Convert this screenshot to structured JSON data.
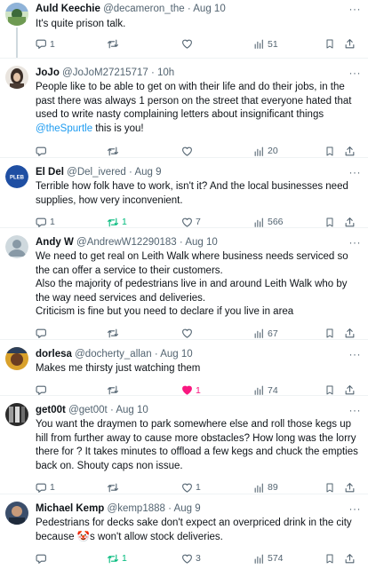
{
  "tweets": [
    {
      "name": "Auld Keechie",
      "handle": "@decameron_the",
      "sep": "·",
      "time": "Aug 10",
      "text": "It's quite prison talk.",
      "reply_count": "1",
      "retweet_count": "",
      "like_count": "",
      "views": "51",
      "liked": false,
      "retweeted": false
    },
    {
      "name": "JoJo",
      "handle": "@JoJoM27215717",
      "sep": "·",
      "time": "10h",
      "text_before": "People like to be able to get on with their life and do their jobs, in the past there was always 1 person on the street that everyone hated that used to write nasty complaining letters about insignificant things ",
      "mention": "@theSpurtle",
      "text_after": " this is you!",
      "reply_count": "",
      "retweet_count": "",
      "like_count": "",
      "views": "20",
      "liked": false,
      "retweeted": false
    },
    {
      "name": "El Del",
      "handle": "@Del_ivered",
      "sep": "·",
      "time": "Aug 9",
      "avatar_text": "PLEB",
      "text": "Terrible how folk have to work, isn't it? And the local businesses need supplies, how very inconvenient.",
      "reply_count": "1",
      "retweet_count": "1",
      "like_count": "7",
      "views": "566",
      "liked": false,
      "retweeted": true
    },
    {
      "name": "Andy W",
      "handle": "@AndrewW12290183",
      "sep": "·",
      "time": "Aug 10",
      "lines": [
        "We need to get real on Leith Walk where business needs serviced so the can offer a service to their customers.",
        "Also the majority of pedestrians live in and around Leith Walk who by the way need services and deliveries.",
        "Criticism is fine but you need to declare if you live in area"
      ],
      "reply_count": "",
      "retweet_count": "",
      "like_count": "",
      "views": "67",
      "liked": false,
      "retweeted": false
    },
    {
      "name": "dorlesa",
      "handle": "@docherty_allan",
      "sep": "·",
      "time": "Aug 10",
      "text": "Makes me thirsty just watching them",
      "reply_count": "",
      "retweet_count": "",
      "like_count": "1",
      "views": "74",
      "liked": true,
      "retweeted": false
    },
    {
      "name": "get00t",
      "handle": "@get00t",
      "sep": "·",
      "time": "Aug 10",
      "text": "You want the draymen to park somewhere else and roll those kegs up hill from further away to cause more obstacles? How long was the lorry there for ? It takes minutes to offload a few kegs and chuck the empties back on. Shouty caps non issue.",
      "reply_count": "1",
      "retweet_count": "",
      "like_count": "1",
      "views": "89",
      "liked": false,
      "retweeted": false
    },
    {
      "name": "Michael Kemp",
      "handle": "@kemp1888",
      "sep": "·",
      "time": "Aug 9",
      "text_before": "Pedestrians for decks sake don't expect an overpriced drink in the city because ",
      "emoji": "🤡",
      "text_after": "s won't allow stock deliveries.",
      "reply_count": "",
      "retweet_count": "1",
      "like_count": "3",
      "views": "574",
      "liked": false,
      "retweeted": true
    }
  ],
  "more_glyph": "···",
  "colors": {
    "link": "#1d9bf0",
    "retweet_active": "#00ba7c",
    "like_active": "#f91880",
    "muted": "#536471",
    "divider": "#eff3f4",
    "thread_line": "#cfd9de"
  },
  "icons": [
    "reply-icon",
    "retweet-icon",
    "like-icon",
    "views-icon",
    "bookmark-icon",
    "share-icon",
    "more-icon"
  ]
}
